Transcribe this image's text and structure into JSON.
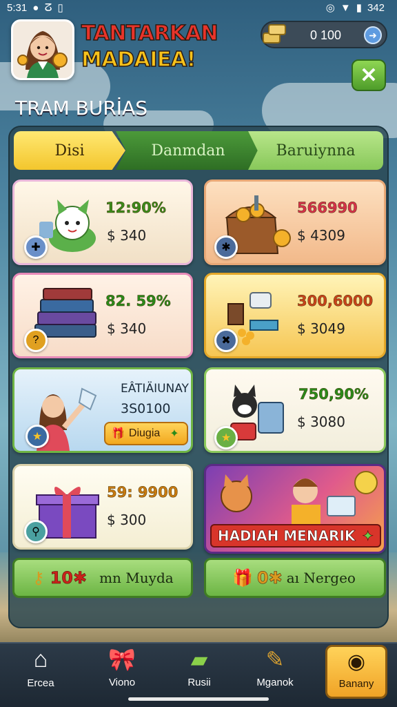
{
  "status_bar": {
    "time": "5:31",
    "battery": "342"
  },
  "header": {
    "title_line1": "TANTARKAN",
    "title_line2": "MADAIEA!",
    "currency_value": "0  100",
    "section_title": "TRAM BURİAS"
  },
  "tabs": [
    {
      "label": "Disi",
      "active": true
    },
    {
      "label": "Danmdan",
      "active": false
    },
    {
      "label": "Baruiynna",
      "active": false
    }
  ],
  "cards": [
    {
      "id": "pet",
      "percent": "12:90%",
      "price": "$ 340",
      "percent_color": "#3a8a1a"
    },
    {
      "id": "chest",
      "percent": "566990",
      "price": "$ 4309",
      "percent_color": "#d8304a"
    },
    {
      "id": "books",
      "percent": "82. 59%",
      "price": "$ 340",
      "percent_color": "#2a8a1a"
    },
    {
      "id": "items",
      "percent": "300,6000",
      "price": "$ 3049",
      "percent_color": "#c8421a"
    },
    {
      "id": "promo",
      "title": "EÂTIÄIUNAY",
      "subtitle": "3S0100",
      "button_label": "Diugia"
    },
    {
      "id": "cat",
      "percent": "750,90%",
      "price": "$ 3080",
      "percent_color": "#2a8a1a"
    },
    {
      "id": "gift",
      "percent": "59: 9900",
      "price": "$ 300",
      "percent_color": "#c87a10"
    },
    {
      "id": "banner",
      "banner_label": "HADIAH MENARIK"
    }
  ],
  "bottom_buttons": [
    {
      "amount": "10✱",
      "label": "mn Muyda"
    },
    {
      "amount": "0✱",
      "label": "aı Nergeo"
    }
  ],
  "nav": [
    {
      "label": "Ercea",
      "icon": "house-icon"
    },
    {
      "label": "Viono",
      "icon": "ribbon-icon"
    },
    {
      "label": "Rusii",
      "icon": "battery-icon"
    },
    {
      "label": "Mganok",
      "icon": "wand-icon"
    },
    {
      "label": "Banany",
      "icon": "coin-icon",
      "active": true
    }
  ]
}
